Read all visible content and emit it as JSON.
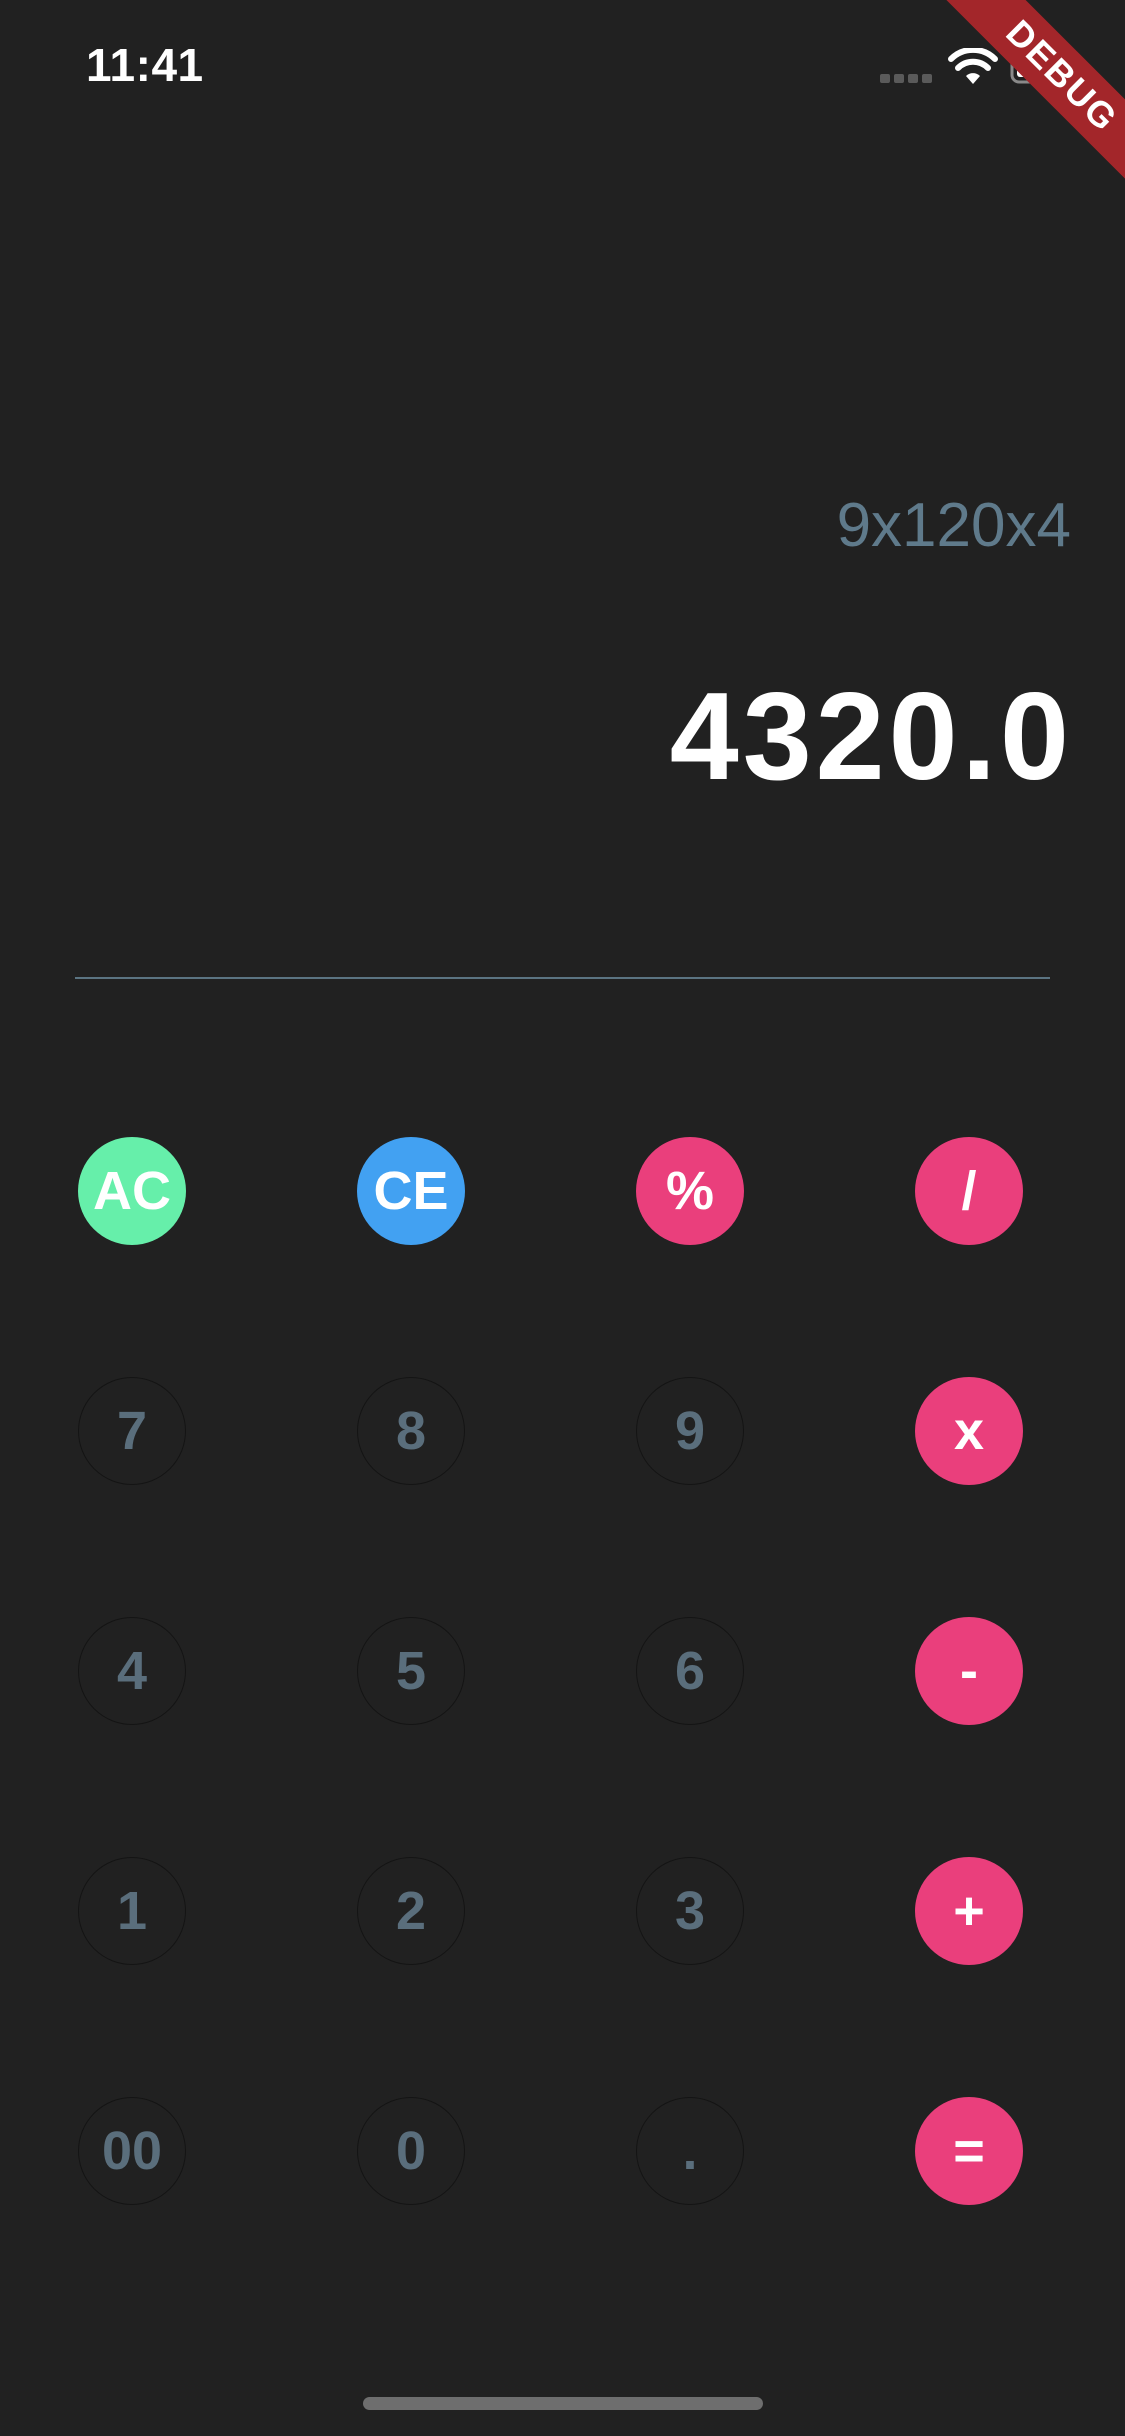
{
  "status_bar": {
    "time": "11:41"
  },
  "debug_banner": {
    "label": "DEBUG"
  },
  "display": {
    "expression": "9x120x4",
    "result": "4320.0"
  },
  "keypad": {
    "rows": [
      [
        "AC",
        "CE",
        "%",
        "/"
      ],
      [
        "7",
        "8",
        "9",
        "x"
      ],
      [
        "4",
        "5",
        "6",
        "-"
      ],
      [
        "1",
        "2",
        "3",
        "+"
      ],
      [
        "00",
        "0",
        ".",
        "="
      ]
    ]
  },
  "colors": {
    "background": "#212121",
    "operator": "#ea3f7c",
    "clear_all": "#66efaa",
    "clear_entry": "#42a1f2",
    "digit_text": "#5a6e7c",
    "expression_text": "#5f7a8b",
    "debug_banner": "#a3262a"
  }
}
